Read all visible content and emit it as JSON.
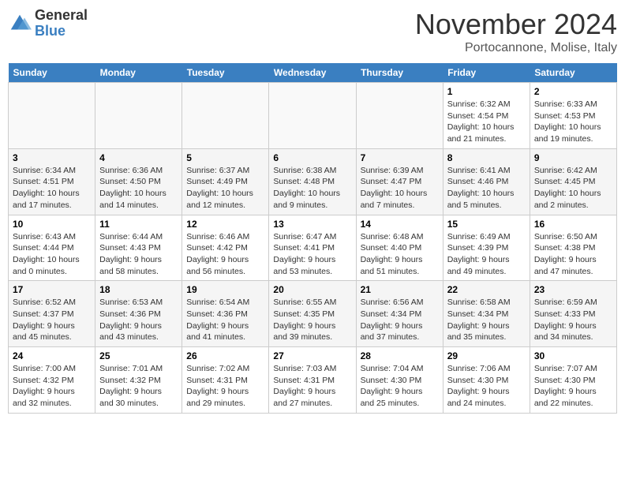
{
  "logo": {
    "general": "General",
    "blue": "Blue"
  },
  "title": "November 2024",
  "location": "Portocannone, Molise, Italy",
  "days_header": [
    "Sunday",
    "Monday",
    "Tuesday",
    "Wednesday",
    "Thursday",
    "Friday",
    "Saturday"
  ],
  "weeks": [
    [
      {
        "day": "",
        "info": ""
      },
      {
        "day": "",
        "info": ""
      },
      {
        "day": "",
        "info": ""
      },
      {
        "day": "",
        "info": ""
      },
      {
        "day": "",
        "info": ""
      },
      {
        "day": "1",
        "info": "Sunrise: 6:32 AM\nSunset: 4:54 PM\nDaylight: 10 hours and 21 minutes."
      },
      {
        "day": "2",
        "info": "Sunrise: 6:33 AM\nSunset: 4:53 PM\nDaylight: 10 hours and 19 minutes."
      }
    ],
    [
      {
        "day": "3",
        "info": "Sunrise: 6:34 AM\nSunset: 4:51 PM\nDaylight: 10 hours and 17 minutes."
      },
      {
        "day": "4",
        "info": "Sunrise: 6:36 AM\nSunset: 4:50 PM\nDaylight: 10 hours and 14 minutes."
      },
      {
        "day": "5",
        "info": "Sunrise: 6:37 AM\nSunset: 4:49 PM\nDaylight: 10 hours and 12 minutes."
      },
      {
        "day": "6",
        "info": "Sunrise: 6:38 AM\nSunset: 4:48 PM\nDaylight: 10 hours and 9 minutes."
      },
      {
        "day": "7",
        "info": "Sunrise: 6:39 AM\nSunset: 4:47 PM\nDaylight: 10 hours and 7 minutes."
      },
      {
        "day": "8",
        "info": "Sunrise: 6:41 AM\nSunset: 4:46 PM\nDaylight: 10 hours and 5 minutes."
      },
      {
        "day": "9",
        "info": "Sunrise: 6:42 AM\nSunset: 4:45 PM\nDaylight: 10 hours and 2 minutes."
      }
    ],
    [
      {
        "day": "10",
        "info": "Sunrise: 6:43 AM\nSunset: 4:44 PM\nDaylight: 10 hours and 0 minutes."
      },
      {
        "day": "11",
        "info": "Sunrise: 6:44 AM\nSunset: 4:43 PM\nDaylight: 9 hours and 58 minutes."
      },
      {
        "day": "12",
        "info": "Sunrise: 6:46 AM\nSunset: 4:42 PM\nDaylight: 9 hours and 56 minutes."
      },
      {
        "day": "13",
        "info": "Sunrise: 6:47 AM\nSunset: 4:41 PM\nDaylight: 9 hours and 53 minutes."
      },
      {
        "day": "14",
        "info": "Sunrise: 6:48 AM\nSunset: 4:40 PM\nDaylight: 9 hours and 51 minutes."
      },
      {
        "day": "15",
        "info": "Sunrise: 6:49 AM\nSunset: 4:39 PM\nDaylight: 9 hours and 49 minutes."
      },
      {
        "day": "16",
        "info": "Sunrise: 6:50 AM\nSunset: 4:38 PM\nDaylight: 9 hours and 47 minutes."
      }
    ],
    [
      {
        "day": "17",
        "info": "Sunrise: 6:52 AM\nSunset: 4:37 PM\nDaylight: 9 hours and 45 minutes."
      },
      {
        "day": "18",
        "info": "Sunrise: 6:53 AM\nSunset: 4:36 PM\nDaylight: 9 hours and 43 minutes."
      },
      {
        "day": "19",
        "info": "Sunrise: 6:54 AM\nSunset: 4:36 PM\nDaylight: 9 hours and 41 minutes."
      },
      {
        "day": "20",
        "info": "Sunrise: 6:55 AM\nSunset: 4:35 PM\nDaylight: 9 hours and 39 minutes."
      },
      {
        "day": "21",
        "info": "Sunrise: 6:56 AM\nSunset: 4:34 PM\nDaylight: 9 hours and 37 minutes."
      },
      {
        "day": "22",
        "info": "Sunrise: 6:58 AM\nSunset: 4:34 PM\nDaylight: 9 hours and 35 minutes."
      },
      {
        "day": "23",
        "info": "Sunrise: 6:59 AM\nSunset: 4:33 PM\nDaylight: 9 hours and 34 minutes."
      }
    ],
    [
      {
        "day": "24",
        "info": "Sunrise: 7:00 AM\nSunset: 4:32 PM\nDaylight: 9 hours and 32 minutes."
      },
      {
        "day": "25",
        "info": "Sunrise: 7:01 AM\nSunset: 4:32 PM\nDaylight: 9 hours and 30 minutes."
      },
      {
        "day": "26",
        "info": "Sunrise: 7:02 AM\nSunset: 4:31 PM\nDaylight: 9 hours and 29 minutes."
      },
      {
        "day": "27",
        "info": "Sunrise: 7:03 AM\nSunset: 4:31 PM\nDaylight: 9 hours and 27 minutes."
      },
      {
        "day": "28",
        "info": "Sunrise: 7:04 AM\nSunset: 4:30 PM\nDaylight: 9 hours and 25 minutes."
      },
      {
        "day": "29",
        "info": "Sunrise: 7:06 AM\nSunset: 4:30 PM\nDaylight: 9 hours and 24 minutes."
      },
      {
        "day": "30",
        "info": "Sunrise: 7:07 AM\nSunset: 4:30 PM\nDaylight: 9 hours and 22 minutes."
      }
    ]
  ]
}
